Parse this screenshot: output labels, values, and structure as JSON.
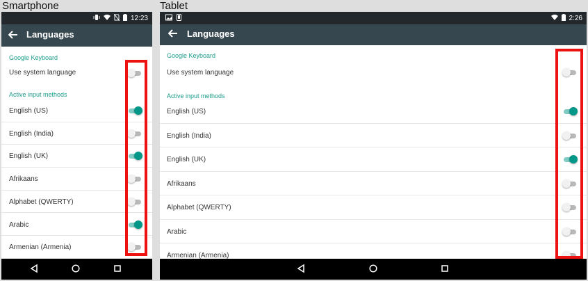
{
  "smartphone": {
    "panel_label": "Smartphone",
    "status_time": "12:23",
    "title": "Languages",
    "section_keyboard": "Google Keyboard",
    "use_system_language": "Use system language",
    "section_active": "Active input methods",
    "items": [
      {
        "label": "English (US)",
        "on": true
      },
      {
        "label": "English (India)",
        "on": false
      },
      {
        "label": "English (UK)",
        "on": true
      },
      {
        "label": "Afrikaans",
        "on": false
      },
      {
        "label": "Alphabet (QWERTY)",
        "on": false
      },
      {
        "label": "Arabic",
        "on": true
      },
      {
        "label": "Armenian (Armenia)",
        "on": false
      }
    ]
  },
  "tablet": {
    "panel_label": "Tablet",
    "status_time": "2:26",
    "title": "Languages",
    "section_keyboard": "Google Keyboard",
    "use_system_language": "Use system language",
    "section_active": "Active input methods",
    "items": [
      {
        "label": "English (US)",
        "on": true
      },
      {
        "label": "English (India)",
        "on": false
      },
      {
        "label": "English (UK)",
        "on": true
      },
      {
        "label": "Afrikaans",
        "on": false
      },
      {
        "label": "Alphabet (QWERTY)",
        "on": false
      },
      {
        "label": "Arabic",
        "on": false
      },
      {
        "label": "Armenian (Armenia)",
        "on": false
      }
    ]
  },
  "colors": {
    "toolbar": "#37474f",
    "statusbar": "#22282b",
    "accent": "#009688",
    "section_text": "#199b89",
    "highlight": "#ee1111"
  },
  "icons": {
    "back": "arrow-left-icon",
    "nav_back": "triangle-back-icon",
    "nav_home": "circle-home-icon",
    "nav_recent": "square-recent-icon"
  }
}
